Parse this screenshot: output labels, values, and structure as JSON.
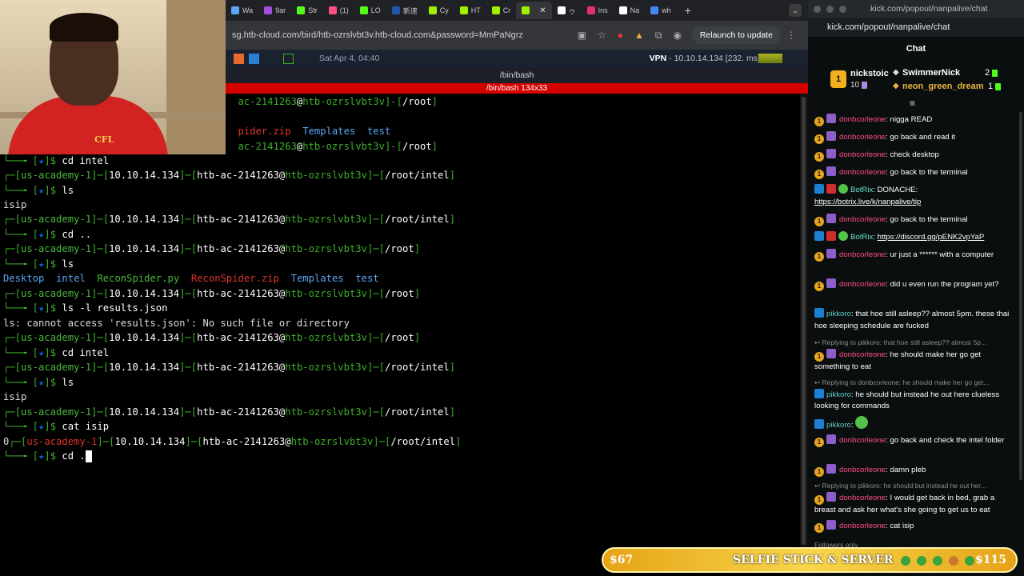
{
  "browser": {
    "tabs": [
      {
        "label": "Wa",
        "color": "#5aa7f5"
      },
      {
        "label": "9ar",
        "color": "#a24ee0"
      },
      {
        "label": "Str",
        "color": "#53fc18"
      },
      {
        "label": "(1)",
        "color": "#ff4e86"
      },
      {
        "label": "LO",
        "color": "#53fc18"
      },
      {
        "label": "新速",
        "color": "#2255aa"
      },
      {
        "label": "Cy",
        "color": "#9fef00"
      },
      {
        "label": "HT",
        "color": "#9fef00"
      },
      {
        "label": "Cr",
        "color": "#9fef00"
      },
      {
        "label": "",
        "color": "#9fef00",
        "active": true
      },
      {
        "label": "ゥ",
        "color": "#ffffff"
      },
      {
        "label": "Ins",
        "color": "#e1306c"
      },
      {
        "label": "Na",
        "color": "#ffffff"
      },
      {
        "label": "wh",
        "color": "#4285f4"
      }
    ],
    "new_tab": "+",
    "tab_menu": "⌄",
    "url": "sg.htb-cloud.com/bird/htb-ozrslvbt3v.htb-cloud.com&password=MmPaNgrz",
    "relaunch_label": "Relaunch to update"
  },
  "vm_panel": {
    "clock": "Sat Apr  4, 04:40",
    "vpn_label": "VPN",
    "vpn_value": "- 10.10.14.134 [232. ms]"
  },
  "terminal": {
    "title": "/bin/bash",
    "subtitle": "/bin/bash 134x33"
  },
  "webcam": {
    "shirt_text": "CFL"
  },
  "chat": {
    "window_title": "kick.com/popout/nanpalive/chat",
    "url": "kick.com/popout/nanpalive/chat",
    "header": "Chat",
    "leaderboard": {
      "top_user": "nickstoic",
      "top_count": "10",
      "user2": "SwimmerNick",
      "user2_count": "2",
      "user3": "neon_green_dream",
      "user3_count": "1"
    },
    "messages": [
      {
        "user": "donbcorleone",
        "text": ": nigga READ"
      },
      {
        "user": "donbcorleone",
        "text": ": go back and read it"
      },
      {
        "user": "donbcorleone",
        "text": ": check desktop"
      },
      {
        "user": "donbcorleone",
        "text": ": go back to the terminal"
      },
      {
        "user": "BotRix",
        "text": ": DONACHE:",
        "link": "https://botrix.live/k/nanpalive/tip"
      },
      {
        "user": "donbcorleone",
        "text": ": go back to the terminal"
      },
      {
        "user": "BotRix",
        "text": ": ",
        "link": "https://discord.gg/pENK2vpYaP"
      },
      {
        "user": "donbcorleone",
        "text": ": ur just a ****** with a computer"
      },
      {
        "user": "donbcorleone",
        "text": ": did u even run the program yet?"
      },
      {
        "user": "pikkoro",
        "text": ": that hoe still asleep?? almost 5pm. these thai hoe sleeping schedule are fucked"
      },
      {
        "reply": "Replying to pikkoro: that hoe still asleep?? almost 5p...",
        "user": "donbcorleone",
        "text": ": he should make her go get something to eat"
      },
      {
        "reply": "Replying to donbcorleone: he should make her go get...",
        "user": "pikkoro",
        "text": ": he should but instead he out here clueless looking for commands"
      },
      {
        "user": "pikkoro",
        "text": ":"
      },
      {
        "user": "donbcorleone",
        "text": ": go back and check the intel folder"
      },
      {
        "user": "donbcorleone",
        "text": ": damn pleb"
      },
      {
        "reply": "Replying to pikkoro: he should but instead he out her...",
        "user": "donbcorleone",
        "text": ": I would get back in bed, grab a breast and ask her what's she going to get us to eat"
      },
      {
        "user": "donbcorleone",
        "text": ": cat isip"
      }
    ],
    "followers_only": "Followers only"
  },
  "goal_banner": {
    "left_amount": "$67",
    "title": "SELFIE STICK & SERVER",
    "right_amount": "$115"
  }
}
